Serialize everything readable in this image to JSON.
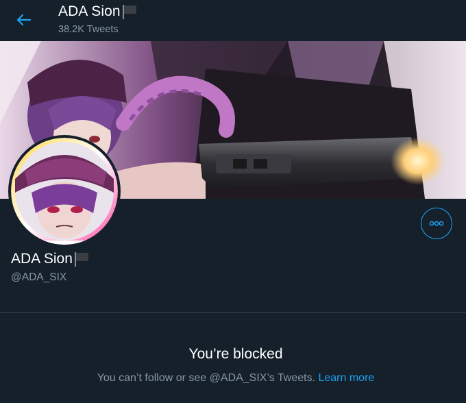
{
  "header": {
    "name": "ADA Sion",
    "tweet_count": "38.2K Tweets",
    "back_icon": "arrow-left-icon",
    "flag_icon": "black-flag-icon"
  },
  "profile": {
    "name": "ADA Sion",
    "handle": "@ADA_SIX",
    "more_icon": "more-horizontal-icon"
  },
  "blocked": {
    "title": "You’re blocked",
    "message": "You can’t follow or see @ADA_SIX’s Tweets.",
    "link": "Learn more"
  },
  "colors": {
    "background": "#15202b",
    "accent": "#1da1f2",
    "secondary_text": "#8899a6",
    "divider": "#38444d"
  }
}
